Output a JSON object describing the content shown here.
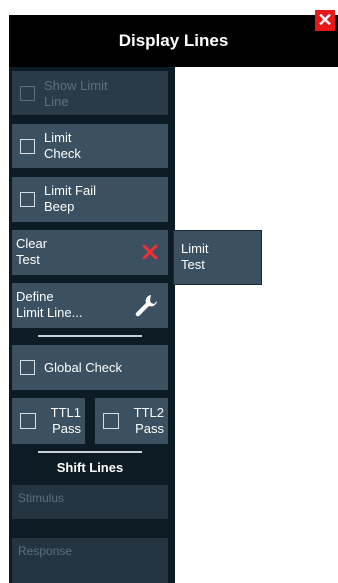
{
  "dialog": {
    "title": "Display Lines",
    "close_glyph": "✕"
  },
  "buttons": {
    "show_limit_line": "Show Limit\nLine",
    "limit_check": "Limit\nCheck",
    "limit_fail_beep": "Limit Fail\nBeep",
    "clear_test": "Clear\nTest",
    "define_limit_line": "Define\nLimit Line...",
    "global_check": "Global Check",
    "ttl1_pass": "TTL1\nPass",
    "ttl2_pass": "TTL2\nPass"
  },
  "section": {
    "shift_lines": "Shift Lines"
  },
  "fields": {
    "stimulus": "Stimulus",
    "response": "Response"
  },
  "popup": {
    "limit_test": "Limit\nTest"
  },
  "icons": {
    "clear": "close-x-icon",
    "define": "wrench-icon"
  },
  "colors": {
    "accent_red": "#e81818",
    "button_bg": "#3b5060",
    "panel_bg": "#0d1b24"
  }
}
